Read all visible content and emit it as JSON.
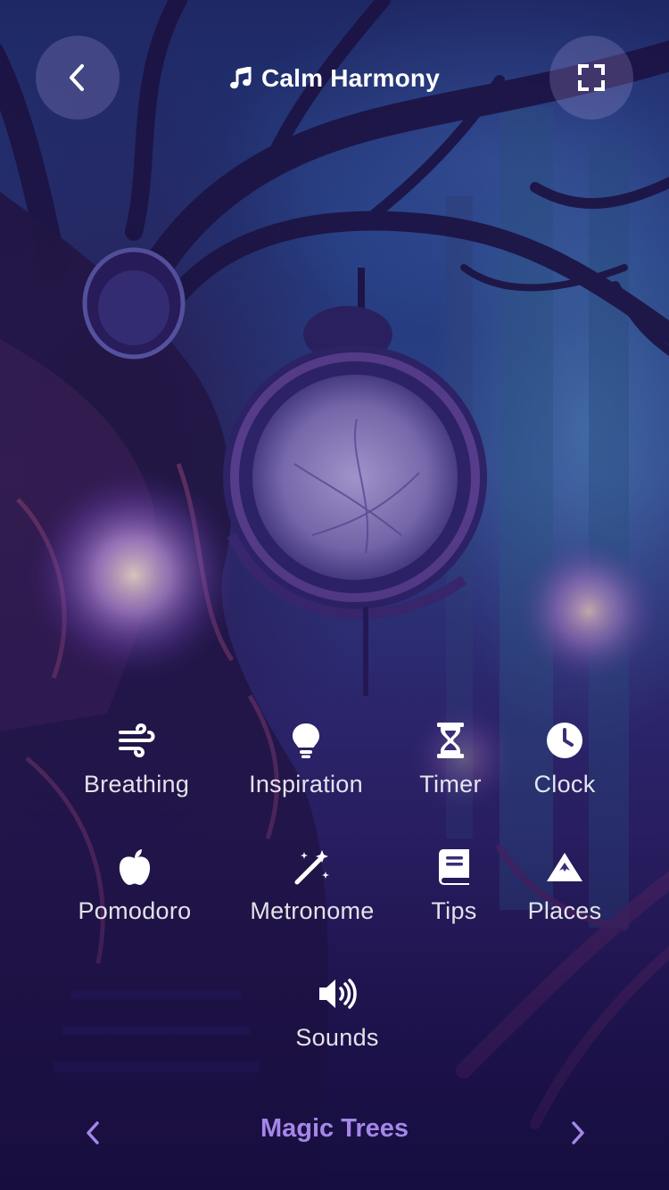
{
  "header": {
    "title": "Calm Harmony",
    "back_icon": "chevron-left-icon",
    "music_icon": "music-note-icon",
    "fullscreen_icon": "fullscreen-icon"
  },
  "features": [
    {
      "label": "Breathing",
      "icon": "wind-icon"
    },
    {
      "label": "Inspiration",
      "icon": "lightbulb-icon"
    },
    {
      "label": "Timer",
      "icon": "hourglass-icon"
    },
    {
      "label": "Clock",
      "icon": "clock-icon"
    },
    {
      "label": "Pomodoro",
      "icon": "apple-icon"
    },
    {
      "label": "Metronome",
      "icon": "magic-wand-icon"
    },
    {
      "label": "Tips",
      "icon": "book-icon"
    },
    {
      "label": "Places",
      "icon": "mountain-icon"
    },
    {
      "label": "Sounds",
      "icon": "speaker-icon"
    }
  ],
  "scene": {
    "name": "Magic Trees",
    "prev_icon": "chevron-left-icon",
    "next_icon": "chevron-right-icon",
    "accent": "#a487e8"
  }
}
